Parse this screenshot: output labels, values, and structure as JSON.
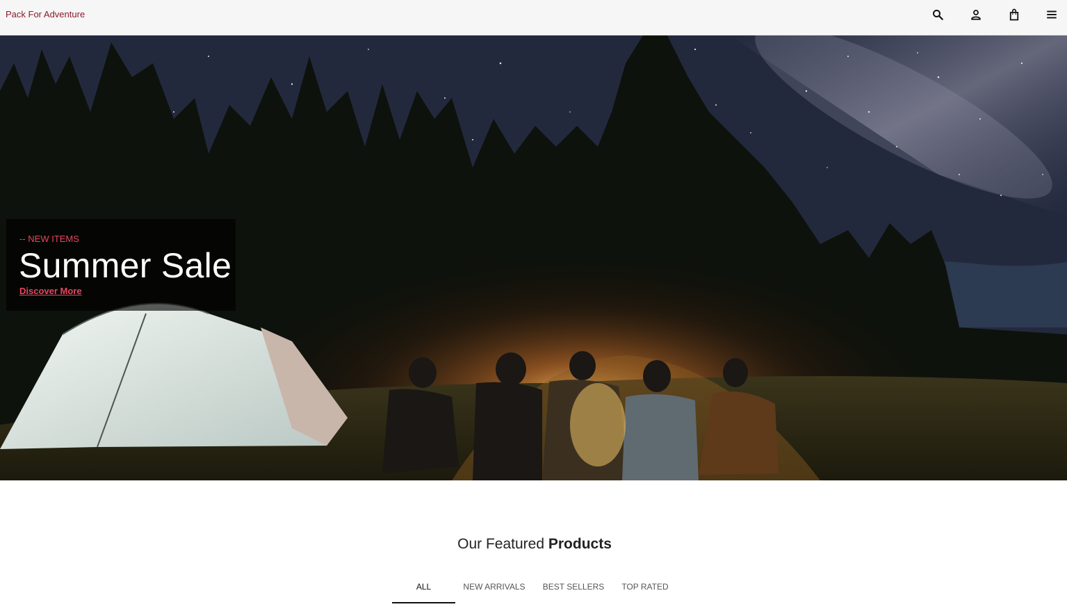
{
  "header": {
    "brand": "Pack For Adventure",
    "icons": [
      "search-icon",
      "user-icon",
      "bag-icon",
      "menu-icon"
    ]
  },
  "hero": {
    "tag": "-- NEW ITEMS",
    "title": "Summer Sale",
    "link": "Discover More",
    "accent_color": "#e8455f"
  },
  "featured": {
    "title_light": "Our Featured",
    "title_bold": "Products",
    "tabs": [
      {
        "label": "ALL",
        "active": true
      },
      {
        "label": "NEW ARRIVALS",
        "active": false
      },
      {
        "label": "BEST SELLERS",
        "active": false
      },
      {
        "label": "TOP RATED",
        "active": false
      }
    ]
  },
  "colors": {
    "brand": "#8b1a2a",
    "accent": "#e8455f"
  }
}
